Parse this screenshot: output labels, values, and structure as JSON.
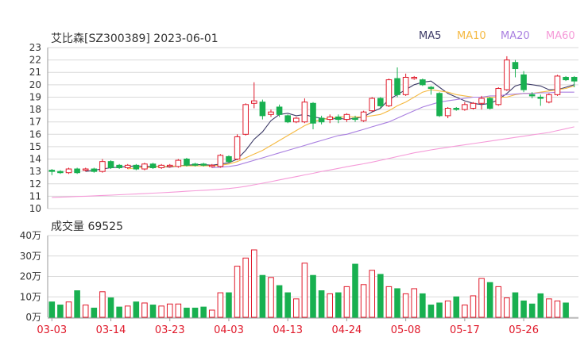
{
  "header": {
    "title": "艾比森[SZ300389] 2023-06-01",
    "legend": [
      {
        "label": "MA5",
        "color": "#3c3a66"
      },
      {
        "label": "MA10",
        "color": "#f5b941"
      },
      {
        "label": "MA20",
        "color": "#a97fe0"
      },
      {
        "label": "MA60",
        "color": "#f59ad8"
      }
    ],
    "volume_title": "成交量 69525"
  },
  "colors": {
    "up": "#e0192a",
    "down": "#18b050",
    "grid": "#d9d9d9"
  },
  "chart_data": [
    {
      "type": "candlestick",
      "ylim": [
        10,
        23
      ],
      "yticks": [
        "10",
        "11",
        "12",
        "13",
        "14",
        "15",
        "16",
        "17",
        "18",
        "19",
        "20",
        "21",
        "22",
        "23"
      ],
      "xticks": [
        "03-03",
        "03-14",
        "03-23",
        "04-03",
        "04-13",
        "04-24",
        "05-08",
        "05-17",
        "05-26"
      ],
      "xtick_index": [
        0,
        7,
        14,
        21,
        28,
        35,
        42,
        49,
        56
      ],
      "candles": [
        [
          13.0,
          13.1,
          12.7,
          13.2,
          "d"
        ],
        [
          13.0,
          12.9,
          12.8,
          13.1,
          "d"
        ],
        [
          12.9,
          13.2,
          12.8,
          13.3,
          "u"
        ],
        [
          12.9,
          13.2,
          12.8,
          13.3,
          "d"
        ],
        [
          13.1,
          13.2,
          13.0,
          13.3,
          "u"
        ],
        [
          13.2,
          13.0,
          12.9,
          13.3,
          "d"
        ],
        [
          13.0,
          13.8,
          12.9,
          14.0,
          "u"
        ],
        [
          13.8,
          13.3,
          13.2,
          13.9,
          "d"
        ],
        [
          13.5,
          13.3,
          13.2,
          13.6,
          "d"
        ],
        [
          13.3,
          13.5,
          13.2,
          13.6,
          "u"
        ],
        [
          13.5,
          13.2,
          13.1,
          13.6,
          "d"
        ],
        [
          13.2,
          13.6,
          13.1,
          13.7,
          "u"
        ],
        [
          13.6,
          13.3,
          13.2,
          13.7,
          "d"
        ],
        [
          13.3,
          13.5,
          13.2,
          13.6,
          "u"
        ],
        [
          13.4,
          13.5,
          13.3,
          13.6,
          "u"
        ],
        [
          13.4,
          13.9,
          13.3,
          14.0,
          "u"
        ],
        [
          14.0,
          13.5,
          13.4,
          14.1,
          "d"
        ],
        [
          13.6,
          13.5,
          13.4,
          13.7,
          "d"
        ],
        [
          13.6,
          13.5,
          13.4,
          13.7,
          "d"
        ],
        [
          13.4,
          13.5,
          13.3,
          13.6,
          "u"
        ],
        [
          13.4,
          14.3,
          13.3,
          14.4,
          "u"
        ],
        [
          14.2,
          13.8,
          13.7,
          14.3,
          "d"
        ],
        [
          14.0,
          15.8,
          13.9,
          16.0,
          "u"
        ],
        [
          16.0,
          18.4,
          15.9,
          18.5,
          "u"
        ],
        [
          18.5,
          18.7,
          18.1,
          20.2,
          "u"
        ],
        [
          18.6,
          17.5,
          17.2,
          18.8,
          "d"
        ],
        [
          17.6,
          17.8,
          17.4,
          18.0,
          "u"
        ],
        [
          18.2,
          17.6,
          17.4,
          18.4,
          "d"
        ],
        [
          17.5,
          17.0,
          16.9,
          17.6,
          "d"
        ],
        [
          17.0,
          17.3,
          16.9,
          17.4,
          "u"
        ],
        [
          17.0,
          18.6,
          16.9,
          18.9,
          "u"
        ],
        [
          18.5,
          16.9,
          16.4,
          18.6,
          "d"
        ],
        [
          17.3,
          17.0,
          16.8,
          17.5,
          "d"
        ],
        [
          17.2,
          17.4,
          16.9,
          17.6,
          "u"
        ],
        [
          17.4,
          17.2,
          16.9,
          17.6,
          "d"
        ],
        [
          17.2,
          17.6,
          17.0,
          17.7,
          "u"
        ],
        [
          17.3,
          17.2,
          17.0,
          17.5,
          "d"
        ],
        [
          17.1,
          17.8,
          17.0,
          17.9,
          "u"
        ],
        [
          17.9,
          18.9,
          17.8,
          19.0,
          "u"
        ],
        [
          18.9,
          18.3,
          18.1,
          19.0,
          "d"
        ],
        [
          18.3,
          20.4,
          18.2,
          20.5,
          "u"
        ],
        [
          20.5,
          19.2,
          19.0,
          21.4,
          "d"
        ],
        [
          19.2,
          20.6,
          19.1,
          20.9,
          "u"
        ],
        [
          20.5,
          20.6,
          20.4,
          20.7,
          "u"
        ],
        [
          20.4,
          20.0,
          19.9,
          20.5,
          "d"
        ],
        [
          19.8,
          19.7,
          19.2,
          19.9,
          "d"
        ],
        [
          19.3,
          17.5,
          17.4,
          19.4,
          "d"
        ],
        [
          17.5,
          18.1,
          17.3,
          18.2,
          "u"
        ],
        [
          18.1,
          18.0,
          17.9,
          18.2,
          "d"
        ],
        [
          18.0,
          18.4,
          17.9,
          18.6,
          "u"
        ],
        [
          18.1,
          18.5,
          18.0,
          18.6,
          "u"
        ],
        [
          18.5,
          18.9,
          18.0,
          19.1,
          "u"
        ],
        [
          18.9,
          18.1,
          18.0,
          19.0,
          "d"
        ],
        [
          18.4,
          19.7,
          18.3,
          19.8,
          "u"
        ],
        [
          19.6,
          22.0,
          19.5,
          22.3,
          "u"
        ],
        [
          21.8,
          21.3,
          20.6,
          22.0,
          "d"
        ],
        [
          20.8,
          19.6,
          19.4,
          21.1,
          "d"
        ],
        [
          19.2,
          19.1,
          18.9,
          19.4,
          "d"
        ],
        [
          19.0,
          18.9,
          18.3,
          19.2,
          "d"
        ],
        [
          18.6,
          19.2,
          18.5,
          19.3,
          "u"
        ],
        [
          19.2,
          20.7,
          19.1,
          20.8,
          "u"
        ],
        [
          20.6,
          20.4,
          20.3,
          20.7,
          "d"
        ],
        [
          20.6,
          20.3,
          19.8,
          20.7,
          "d"
        ]
      ],
      "ma_series": [
        {
          "name": "MA5",
          "values": [
            null,
            null,
            null,
            null,
            13.0,
            13.1,
            13.2,
            13.3,
            13.35,
            13.4,
            13.45,
            13.4,
            13.4,
            13.4,
            13.35,
            13.45,
            13.5,
            13.55,
            13.55,
            13.5,
            13.6,
            13.7,
            14.0,
            14.7,
            15.6,
            16.2,
            17.1,
            17.6,
            17.7,
            17.5,
            17.6,
            17.4,
            17.3,
            17.2,
            17.3,
            17.2,
            17.3,
            17.4,
            17.8,
            18.1,
            18.8,
            19.2,
            19.6,
            20.0,
            20.2,
            20.3,
            19.8,
            19.3,
            19.0,
            18.7,
            18.5,
            18.4,
            18.5,
            18.8,
            19.3,
            19.9,
            20.1,
            20.0,
            19.9,
            19.6,
            19.6,
            19.8,
            20.0
          ]
        },
        {
          "name": "MA10",
          "values": [
            null,
            null,
            null,
            null,
            null,
            null,
            null,
            null,
            null,
            13.2,
            13.3,
            13.3,
            13.35,
            13.4,
            13.4,
            13.45,
            13.45,
            13.45,
            13.45,
            13.45,
            13.5,
            13.6,
            13.8,
            14.1,
            14.4,
            14.7,
            15.1,
            15.5,
            15.9,
            16.3,
            16.7,
            17.0,
            17.2,
            17.3,
            17.4,
            17.4,
            17.4,
            17.4,
            17.5,
            17.6,
            17.9,
            18.3,
            18.6,
            19.0,
            19.4,
            19.6,
            19.5,
            19.4,
            19.2,
            19.1,
            19.0,
            19.0,
            19.0,
            19.0,
            19.0,
            19.2,
            19.3,
            19.3,
            19.4,
            19.5,
            19.6,
            19.7,
            19.9
          ]
        },
        {
          "name": "MA20",
          "values": [
            null,
            null,
            null,
            null,
            null,
            null,
            null,
            null,
            null,
            null,
            null,
            null,
            null,
            null,
            null,
            null,
            null,
            null,
            null,
            13.3,
            13.35,
            13.4,
            13.5,
            13.7,
            13.9,
            14.1,
            14.3,
            14.5,
            14.7,
            14.9,
            15.1,
            15.3,
            15.5,
            15.7,
            15.9,
            16.0,
            16.2,
            16.4,
            16.6,
            16.8,
            17.0,
            17.3,
            17.6,
            17.9,
            18.2,
            18.4,
            18.6,
            18.7,
            18.8,
            18.9,
            19.0,
            19.0,
            19.1,
            19.1,
            19.2,
            19.25,
            19.3,
            19.3,
            19.35,
            19.35,
            19.4,
            19.4,
            19.4
          ]
        },
        {
          "name": "MA60",
          "values": [
            10.9,
            10.92,
            10.95,
            10.98,
            11.0,
            11.03,
            11.06,
            11.09,
            11.12,
            11.15,
            11.18,
            11.21,
            11.25,
            11.28,
            11.32,
            11.36,
            11.4,
            11.44,
            11.48,
            11.52,
            11.56,
            11.62,
            11.7,
            11.8,
            11.92,
            12.05,
            12.18,
            12.32,
            12.45,
            12.58,
            12.72,
            12.85,
            13.0,
            13.12,
            13.25,
            13.38,
            13.5,
            13.62,
            13.75,
            13.9,
            14.05,
            14.2,
            14.35,
            14.5,
            14.62,
            14.74,
            14.85,
            14.95,
            15.05,
            15.15,
            15.25,
            15.35,
            15.45,
            15.55,
            15.65,
            15.75,
            15.85,
            15.95,
            16.05,
            16.15,
            16.3,
            16.45,
            16.6
          ]
        }
      ]
    },
    {
      "type": "bar",
      "title": "成交量 69525",
      "ylim": [
        0,
        40
      ],
      "yticks": [
        "0万",
        "10万",
        "20万",
        "30万",
        "40万"
      ],
      "values": [
        7.5,
        6,
        7.5,
        13,
        6,
        4.5,
        12.5,
        9.5,
        5,
        5.5,
        7.5,
        7,
        6,
        5.5,
        6.5,
        6.5,
        4.5,
        4.5,
        5,
        3.5,
        12,
        12,
        25,
        29,
        33,
        20.5,
        19.5,
        15.5,
        12,
        9,
        26.5,
        20.5,
        13,
        11.5,
        12,
        15,
        26,
        16,
        23,
        21,
        15,
        14,
        11.5,
        14,
        11.5,
        6,
        7,
        8,
        10,
        6,
        10.5,
        19,
        17,
        15,
        9.5,
        12,
        8,
        6.5,
        11.5,
        9,
        8,
        7
      ]
    }
  ]
}
